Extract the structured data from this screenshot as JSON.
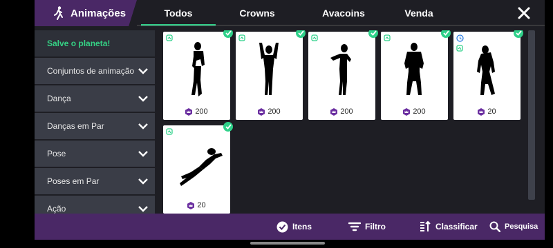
{
  "header": {
    "title": "Animações",
    "tabs": [
      {
        "label": "Todos",
        "active": true
      },
      {
        "label": "Crowns",
        "active": false
      },
      {
        "label": "Avacoins",
        "active": false
      },
      {
        "label": "Venda",
        "active": false
      }
    ]
  },
  "sidebar": {
    "items": [
      {
        "label": "Salve o planeta!",
        "highlight": true
      },
      {
        "label": "Conjuntos de animação"
      },
      {
        "label": "Dança"
      },
      {
        "label": "Danças em Par"
      },
      {
        "label": "Pose"
      },
      {
        "label": "Poses em Par"
      },
      {
        "label": "Ação"
      }
    ]
  },
  "items": [
    {
      "price": "200",
      "icon": "standing-pose",
      "owned": true
    },
    {
      "price": "200",
      "icon": "arms-raised-pose",
      "owned": true
    },
    {
      "price": "200",
      "icon": "dancing-pose",
      "owned": true
    },
    {
      "price": "200",
      "icon": "fists-clenched-pose",
      "owned": true
    },
    {
      "price": "20",
      "icon": "slouched-pose",
      "owned": true,
      "timed": true
    },
    {
      "price": "20",
      "icon": "lying-down-pose",
      "owned": true
    }
  ],
  "bottombar": {
    "items_label": "Itens",
    "filter_label": "Filtro",
    "sort_label": "Classificar",
    "search_label": "Pesquisa"
  },
  "colors": {
    "accent": "#2fd18a",
    "purple": "#4a2866",
    "background": "#1e1e24",
    "sidebar_item": "#3a3d47",
    "highlight_text": "#35d084"
  }
}
